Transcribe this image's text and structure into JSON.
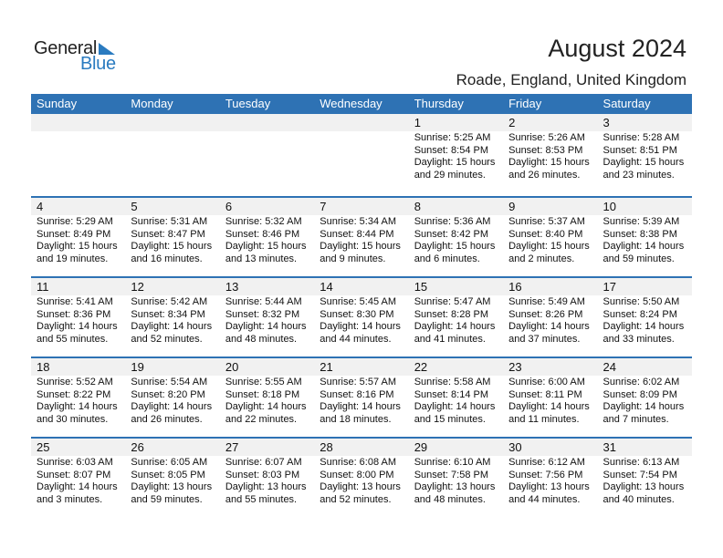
{
  "logo": {
    "line1": "General",
    "line2": "Blue",
    "icon": "triangle-flag-icon"
  },
  "header": {
    "title": "August 2024",
    "location": "Roade, England, United Kingdom"
  },
  "colors": {
    "accent": "#2e72b4",
    "day_row_bg": "#f1f1f1",
    "logo_blue": "#2a7bc0"
  },
  "weekdays": [
    "Sunday",
    "Monday",
    "Tuesday",
    "Wednesday",
    "Thursday",
    "Friday",
    "Saturday"
  ],
  "weeks": [
    [
      null,
      null,
      null,
      null,
      {
        "day": "1",
        "sunrise": "Sunrise: 5:25 AM",
        "sunset": "Sunset: 8:54 PM",
        "daylight1": "Daylight: 15 hours",
        "daylight2": "and 29 minutes."
      },
      {
        "day": "2",
        "sunrise": "Sunrise: 5:26 AM",
        "sunset": "Sunset: 8:53 PM",
        "daylight1": "Daylight: 15 hours",
        "daylight2": "and 26 minutes."
      },
      {
        "day": "3",
        "sunrise": "Sunrise: 5:28 AM",
        "sunset": "Sunset: 8:51 PM",
        "daylight1": "Daylight: 15 hours",
        "daylight2": "and 23 minutes."
      }
    ],
    [
      {
        "day": "4",
        "sunrise": "Sunrise: 5:29 AM",
        "sunset": "Sunset: 8:49 PM",
        "daylight1": "Daylight: 15 hours",
        "daylight2": "and 19 minutes."
      },
      {
        "day": "5",
        "sunrise": "Sunrise: 5:31 AM",
        "sunset": "Sunset: 8:47 PM",
        "daylight1": "Daylight: 15 hours",
        "daylight2": "and 16 minutes."
      },
      {
        "day": "6",
        "sunrise": "Sunrise: 5:32 AM",
        "sunset": "Sunset: 8:46 PM",
        "daylight1": "Daylight: 15 hours",
        "daylight2": "and 13 minutes."
      },
      {
        "day": "7",
        "sunrise": "Sunrise: 5:34 AM",
        "sunset": "Sunset: 8:44 PM",
        "daylight1": "Daylight: 15 hours",
        "daylight2": "and 9 minutes."
      },
      {
        "day": "8",
        "sunrise": "Sunrise: 5:36 AM",
        "sunset": "Sunset: 8:42 PM",
        "daylight1": "Daylight: 15 hours",
        "daylight2": "and 6 minutes."
      },
      {
        "day": "9",
        "sunrise": "Sunrise: 5:37 AM",
        "sunset": "Sunset: 8:40 PM",
        "daylight1": "Daylight: 15 hours",
        "daylight2": "and 2 minutes."
      },
      {
        "day": "10",
        "sunrise": "Sunrise: 5:39 AM",
        "sunset": "Sunset: 8:38 PM",
        "daylight1": "Daylight: 14 hours",
        "daylight2": "and 59 minutes."
      }
    ],
    [
      {
        "day": "11",
        "sunrise": "Sunrise: 5:41 AM",
        "sunset": "Sunset: 8:36 PM",
        "daylight1": "Daylight: 14 hours",
        "daylight2": "and 55 minutes."
      },
      {
        "day": "12",
        "sunrise": "Sunrise: 5:42 AM",
        "sunset": "Sunset: 8:34 PM",
        "daylight1": "Daylight: 14 hours",
        "daylight2": "and 52 minutes."
      },
      {
        "day": "13",
        "sunrise": "Sunrise: 5:44 AM",
        "sunset": "Sunset: 8:32 PM",
        "daylight1": "Daylight: 14 hours",
        "daylight2": "and 48 minutes."
      },
      {
        "day": "14",
        "sunrise": "Sunrise: 5:45 AM",
        "sunset": "Sunset: 8:30 PM",
        "daylight1": "Daylight: 14 hours",
        "daylight2": "and 44 minutes."
      },
      {
        "day": "15",
        "sunrise": "Sunrise: 5:47 AM",
        "sunset": "Sunset: 8:28 PM",
        "daylight1": "Daylight: 14 hours",
        "daylight2": "and 41 minutes."
      },
      {
        "day": "16",
        "sunrise": "Sunrise: 5:49 AM",
        "sunset": "Sunset: 8:26 PM",
        "daylight1": "Daylight: 14 hours",
        "daylight2": "and 37 minutes."
      },
      {
        "day": "17",
        "sunrise": "Sunrise: 5:50 AM",
        "sunset": "Sunset: 8:24 PM",
        "daylight1": "Daylight: 14 hours",
        "daylight2": "and 33 minutes."
      }
    ],
    [
      {
        "day": "18",
        "sunrise": "Sunrise: 5:52 AM",
        "sunset": "Sunset: 8:22 PM",
        "daylight1": "Daylight: 14 hours",
        "daylight2": "and 30 minutes."
      },
      {
        "day": "19",
        "sunrise": "Sunrise: 5:54 AM",
        "sunset": "Sunset: 8:20 PM",
        "daylight1": "Daylight: 14 hours",
        "daylight2": "and 26 minutes."
      },
      {
        "day": "20",
        "sunrise": "Sunrise: 5:55 AM",
        "sunset": "Sunset: 8:18 PM",
        "daylight1": "Daylight: 14 hours",
        "daylight2": "and 22 minutes."
      },
      {
        "day": "21",
        "sunrise": "Sunrise: 5:57 AM",
        "sunset": "Sunset: 8:16 PM",
        "daylight1": "Daylight: 14 hours",
        "daylight2": "and 18 minutes."
      },
      {
        "day": "22",
        "sunrise": "Sunrise: 5:58 AM",
        "sunset": "Sunset: 8:14 PM",
        "daylight1": "Daylight: 14 hours",
        "daylight2": "and 15 minutes."
      },
      {
        "day": "23",
        "sunrise": "Sunrise: 6:00 AM",
        "sunset": "Sunset: 8:11 PM",
        "daylight1": "Daylight: 14 hours",
        "daylight2": "and 11 minutes."
      },
      {
        "day": "24",
        "sunrise": "Sunrise: 6:02 AM",
        "sunset": "Sunset: 8:09 PM",
        "daylight1": "Daylight: 14 hours",
        "daylight2": "and 7 minutes."
      }
    ],
    [
      {
        "day": "25",
        "sunrise": "Sunrise: 6:03 AM",
        "sunset": "Sunset: 8:07 PM",
        "daylight1": "Daylight: 14 hours",
        "daylight2": "and 3 minutes."
      },
      {
        "day": "26",
        "sunrise": "Sunrise: 6:05 AM",
        "sunset": "Sunset: 8:05 PM",
        "daylight1": "Daylight: 13 hours",
        "daylight2": "and 59 minutes."
      },
      {
        "day": "27",
        "sunrise": "Sunrise: 6:07 AM",
        "sunset": "Sunset: 8:03 PM",
        "daylight1": "Daylight: 13 hours",
        "daylight2": "and 55 minutes."
      },
      {
        "day": "28",
        "sunrise": "Sunrise: 6:08 AM",
        "sunset": "Sunset: 8:00 PM",
        "daylight1": "Daylight: 13 hours",
        "daylight2": "and 52 minutes."
      },
      {
        "day": "29",
        "sunrise": "Sunrise: 6:10 AM",
        "sunset": "Sunset: 7:58 PM",
        "daylight1": "Daylight: 13 hours",
        "daylight2": "and 48 minutes."
      },
      {
        "day": "30",
        "sunrise": "Sunrise: 6:12 AM",
        "sunset": "Sunset: 7:56 PM",
        "daylight1": "Daylight: 13 hours",
        "daylight2": "and 44 minutes."
      },
      {
        "day": "31",
        "sunrise": "Sunrise: 6:13 AM",
        "sunset": "Sunset: 7:54 PM",
        "daylight1": "Daylight: 13 hours",
        "daylight2": "and 40 minutes."
      }
    ]
  ]
}
